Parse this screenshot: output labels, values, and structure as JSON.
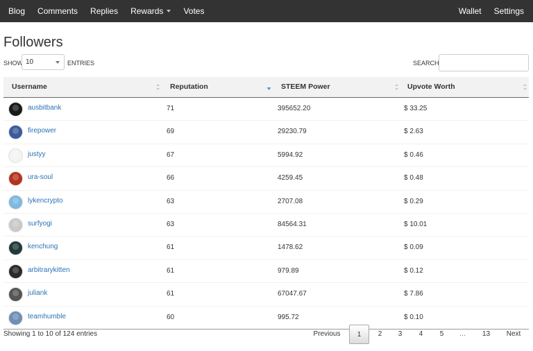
{
  "nav": {
    "left": [
      "Blog",
      "Comments",
      "Replies",
      "Rewards",
      "Votes"
    ],
    "right": [
      "Wallet",
      "Settings"
    ]
  },
  "page": {
    "title": "Followers"
  },
  "controls": {
    "show_label": "Show",
    "entries_value": "10",
    "entries_label": "entries",
    "search_label": "Search:",
    "search_value": ""
  },
  "table": {
    "columns": [
      "Username",
      "Reputation",
      "STEEM Power",
      "Upvote Worth"
    ],
    "sorted_column": "Reputation",
    "sort_direction": "descending",
    "rows": [
      {
        "username": "ausbitbank",
        "reputation": "71",
        "steem_power": "395652.20",
        "upvote_worth": "$ 33.25",
        "avatar_color": "#1a1a1a"
      },
      {
        "username": "firepower",
        "reputation": "69",
        "steem_power": "29230.79",
        "upvote_worth": "$ 2.63",
        "avatar_color": "#3b5b9a"
      },
      {
        "username": "justyy",
        "reputation": "67",
        "steem_power": "5994.92",
        "upvote_worth": "$ 0.46",
        "avatar_color": "#f4f4f4"
      },
      {
        "username": "ura-soul",
        "reputation": "66",
        "steem_power": "4259.45",
        "upvote_worth": "$ 0.48",
        "avatar_color": "#b5321f"
      },
      {
        "username": "lykencrypto",
        "reputation": "63",
        "steem_power": "2707.08",
        "upvote_worth": "$ 0.29",
        "avatar_color": "#7fb8e0"
      },
      {
        "username": "surfyogi",
        "reputation": "63",
        "steem_power": "84564.31",
        "upvote_worth": "$ 10.01",
        "avatar_color": "#c9c9c9"
      },
      {
        "username": "kenchung",
        "reputation": "61",
        "steem_power": "1478.62",
        "upvote_worth": "$ 0.09",
        "avatar_color": "#1f3b3a"
      },
      {
        "username": "arbitrarykitten",
        "reputation": "61",
        "steem_power": "979.89",
        "upvote_worth": "$ 0.12",
        "avatar_color": "#2b2b2b"
      },
      {
        "username": "juliank",
        "reputation": "61",
        "steem_power": "67047.67",
        "upvote_worth": "$ 7.86",
        "avatar_color": "#555555"
      },
      {
        "username": "teamhumble",
        "reputation": "60",
        "steem_power": "995.72",
        "upvote_worth": "$ 0.10",
        "avatar_color": "#6f8fb5"
      }
    ]
  },
  "footer": {
    "info": "Showing 1 to 10 of 124 entries",
    "pagination": [
      "Previous",
      "1",
      "2",
      "3",
      "4",
      "5",
      "…",
      "13",
      "Next"
    ],
    "active_page": "1"
  },
  "colors": {
    "nav_bg": "#333333",
    "link": "#2a73b3",
    "header_bg": "#f2f2f2",
    "sort_active": "#6a8fc7"
  }
}
